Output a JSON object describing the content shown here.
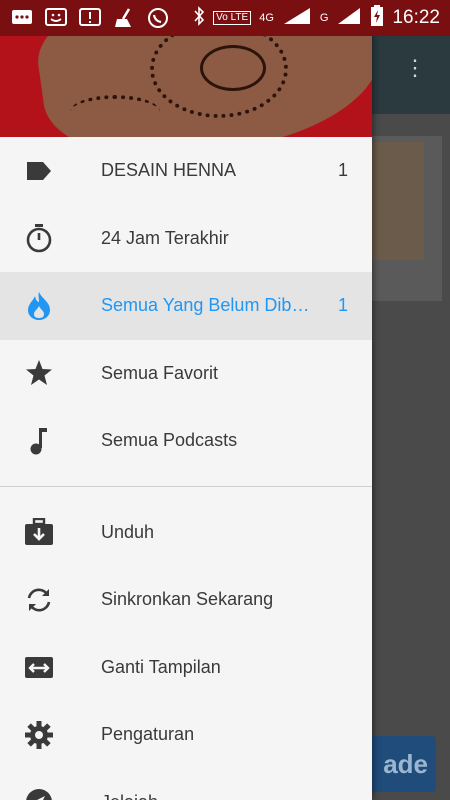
{
  "status_bar": {
    "time": "16:22",
    "lte_badge": "Vo LTE",
    "net_4g": "4G",
    "net_g": "G"
  },
  "background_app": {
    "upgrade_partial": "ade"
  },
  "drawer": {
    "feeds": [
      {
        "label": "DESAIN HENNA",
        "count": "1",
        "icon": "tag-icon"
      },
      {
        "label": "24 Jam Terakhir",
        "count": "",
        "icon": "stopwatch-icon"
      },
      {
        "label": "Semua Yang Belum Dibaca",
        "count": "1",
        "icon": "flame-icon",
        "selected": true
      },
      {
        "label": "Semua Favorit",
        "count": "",
        "icon": "star-icon"
      },
      {
        "label": "Semua Podcasts",
        "count": "",
        "icon": "music-note-icon"
      }
    ],
    "actions": [
      {
        "label": "Unduh",
        "icon": "download-briefcase-icon"
      },
      {
        "label": "Sinkronkan Sekarang",
        "icon": "sync-icon"
      },
      {
        "label": "Ganti Tampilan",
        "icon": "switch-view-icon"
      },
      {
        "label": "Pengaturan",
        "icon": "gear-icon"
      },
      {
        "label": "Jelajah",
        "icon": "compass-icon"
      }
    ],
    "accent_color": "#2196f3"
  }
}
